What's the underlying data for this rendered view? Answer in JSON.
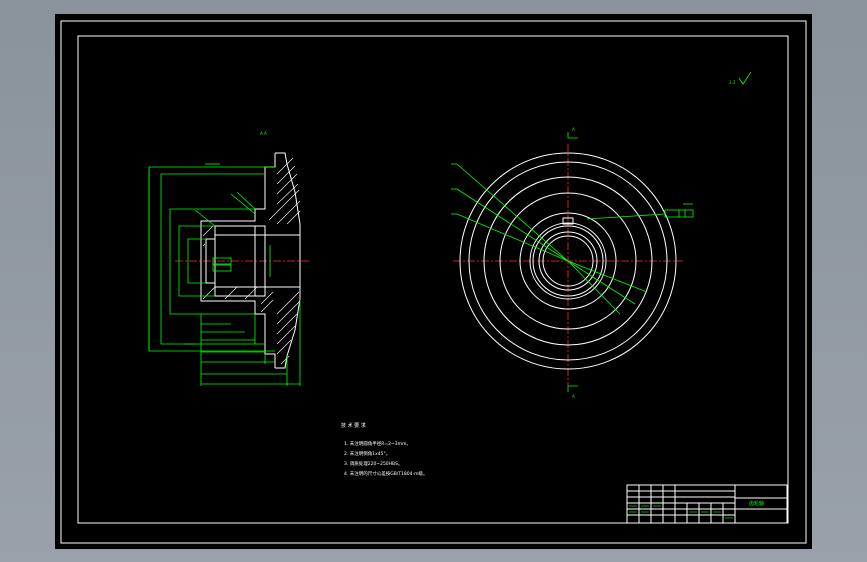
{
  "drawing": {
    "section_label": "A-A",
    "roughness_note": "3.2",
    "cut_marker": "A",
    "tech_requirements_title": "技 术 要 求",
    "tech_requirements": [
      "1. 未注明圆角半径R=2~3mm。",
      "2. 未注明倒角1x45°。",
      "3. 调质处理220~250HBS。",
      "4. 未注明的尺寸公差按GB/T1804-m级。"
    ],
    "title_block_name": "齿轮轴"
  },
  "colors": {
    "outline": "#ffffff",
    "dimension": "#00ff00",
    "centerline": "#ff2a2a"
  }
}
